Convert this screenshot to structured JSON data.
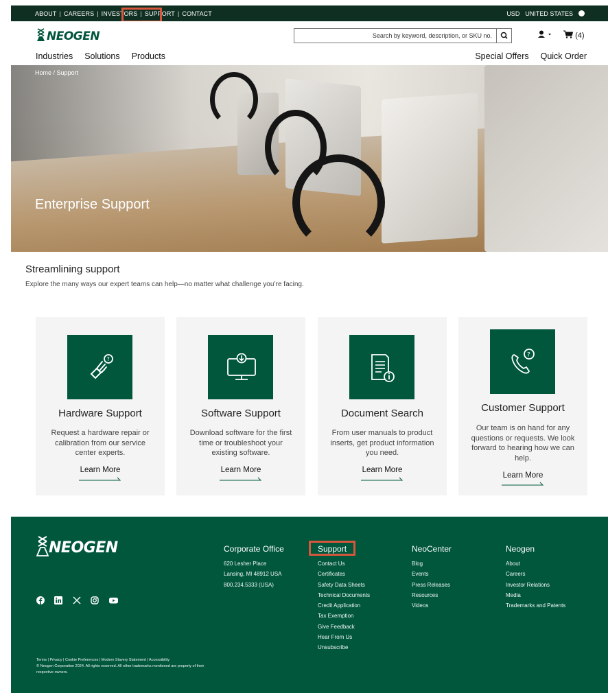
{
  "topbar": {
    "links": [
      "ABOUT",
      "CAREERS",
      "INVESTORS",
      "SUPPORT",
      "CONTACT"
    ],
    "currency": "USD",
    "region": "UNITED STATES"
  },
  "header": {
    "logo_text": "NEOGEN",
    "search_placeholder": "Search by keyword, description, or SKU no.",
    "cart_count": "(4)",
    "nav_left": [
      "Industries",
      "Solutions",
      "Products"
    ],
    "nav_right": [
      "Special Offers",
      "Quick Order"
    ]
  },
  "hero": {
    "breadcrumb": "Home / Support",
    "title": "Enterprise Support"
  },
  "intro": {
    "title": "Streamlining support",
    "subtitle": "Explore the many ways our expert teams can help—no matter what challenge you’re facing."
  },
  "cards": [
    {
      "title": "Hardware Support",
      "desc": "Request a hardware repair or calibration from our service center experts.",
      "link": "Learn More",
      "icon": "hardware-hand-icon"
    },
    {
      "title": "Software Support",
      "desc": "Download software for the first time or troubleshoot your existing software.",
      "link": "Learn More",
      "icon": "monitor-download-icon"
    },
    {
      "title": "Document Search",
      "desc": "From user manuals to product inserts, get product information you need.",
      "link": "Learn More",
      "icon": "document-info-icon"
    },
    {
      "title": "Customer Support",
      "desc": "Our team is on hand for any questions or requests. We look forward to hearing how we can help.",
      "link": "Learn More",
      "icon": "phone-question-icon"
    }
  ],
  "footer": {
    "logo_text": "NEOGEN",
    "columns": [
      {
        "heading": "Corporate Office",
        "items": [
          "620 Lesher Place",
          "Lansing, MI 48912 USA",
          "800.234.5333 (USA)"
        ]
      },
      {
        "heading": "Support",
        "items": [
          "Contact Us",
          "Certificates",
          "Safety Data Sheets",
          "Technical Documents",
          "Credit Application",
          "Tax Exemption",
          "Give Feedback",
          "Hear From Us",
          "Unsubscribe"
        ]
      },
      {
        "heading": "NeoCenter",
        "items": [
          "Blog",
          "Events",
          "Press Releases",
          "Resources",
          "Videos"
        ]
      },
      {
        "heading": "Neogen",
        "items": [
          "About",
          "Careers",
          "Investor Relations",
          "Media",
          "Trademarks and Patents"
        ]
      }
    ],
    "legal_links": "Terms | Privacy | Cookie Preferences | Modern Slavery Statement | Accessibility",
    "copyright": "© Neogen Corporation 2024. All rights reserved. All other trademarks mentioned are property of their respective owners."
  },
  "colors": {
    "brand_green": "#00573b",
    "topbar": "#0f2f22",
    "highlight": "#d8563b"
  }
}
